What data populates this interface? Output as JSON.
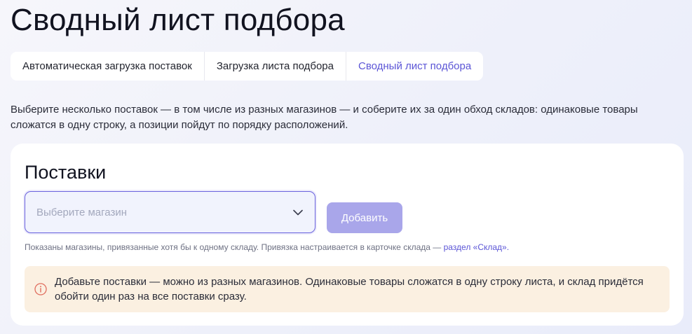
{
  "page": {
    "title": "Сводный лист подбора",
    "intro": "Выберите несколько поставок — в том числе из разных магазинов — и соберите их за один обход складов: одинаковые товары сложатся в одну строку, а позиции пойдут по порядку расположений."
  },
  "tabs": [
    {
      "label": "Автоматическая загрузка поставок",
      "active": false
    },
    {
      "label": "Загрузка листа подбора",
      "active": false
    },
    {
      "label": "Сводный лист подбора",
      "active": true
    }
  ],
  "shipments": {
    "title": "Поставки",
    "store_select": {
      "placeholder": "Выберите магазин",
      "value": "",
      "icon": "chevron-down-icon"
    },
    "add_button": "Добавить",
    "hint": {
      "text": "Показаны магазины, привязанные хотя бы к одному складу. Привязка настраивается в карточке склада — ",
      "link": "раздел «Склад»."
    },
    "alert": {
      "icon": "info-icon",
      "text": "Добавьте поставки — можно из разных магазинов. Одинаковые товары сложатся в одну строку листа, и склад придётся обойти один раз на все поставки сразу."
    }
  },
  "colors": {
    "accent": "#5b55d6",
    "button_disabled": "#a9a6ea",
    "alert_bg": "#fbf0e1",
    "alert_icon": "#e06d5e"
  }
}
